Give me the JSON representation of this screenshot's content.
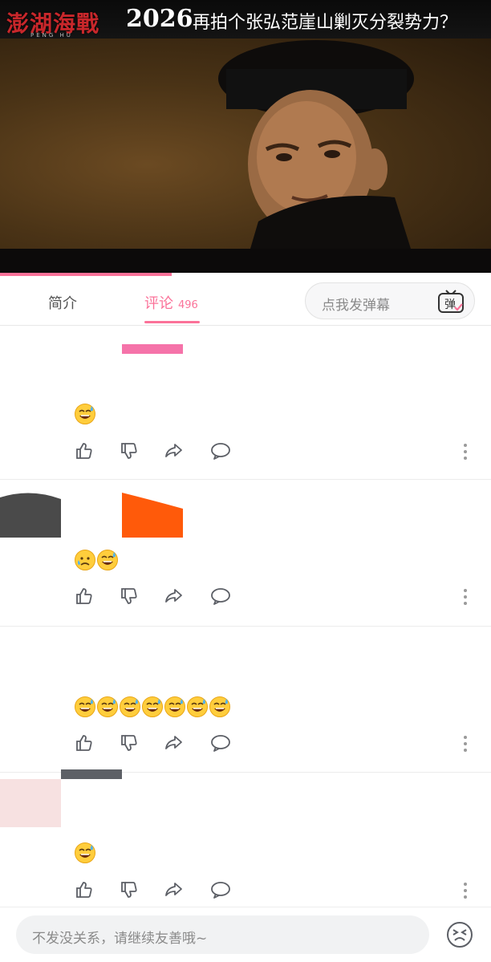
{
  "video": {
    "logo_text": "澎湖海戰",
    "logo_sub": "PENG HU",
    "year": "2026",
    "title": "再拍个张弘范崖山剿灭分裂势力？",
    "progress_percent": 35
  },
  "tabs": {
    "intro_label": "简介",
    "comments_label": "评论",
    "comments_count": "496"
  },
  "danmaku": {
    "placeholder": "点我发弹幕",
    "toggle_icon": "danmaku-toggle-icon",
    "toggle_glyph": "弹"
  },
  "comments": [
    {
      "emojis": [
        "sweat-smile"
      ]
    },
    {
      "emojis": [
        "sad-relieved",
        "sweat-smile"
      ]
    },
    {
      "emojis": [
        "sweat-smile",
        "sweat-smile",
        "sweat-smile",
        "sweat-smile",
        "sweat-smile",
        "sweat-smile",
        "sweat-smile"
      ]
    },
    {
      "emojis": [
        "sweat-smile"
      ]
    }
  ],
  "reply": {
    "placeholder": "不发没关系，请继续友善哦~"
  },
  "colors": {
    "accent": "#fb7299",
    "icon_gray": "#5c5f66"
  }
}
